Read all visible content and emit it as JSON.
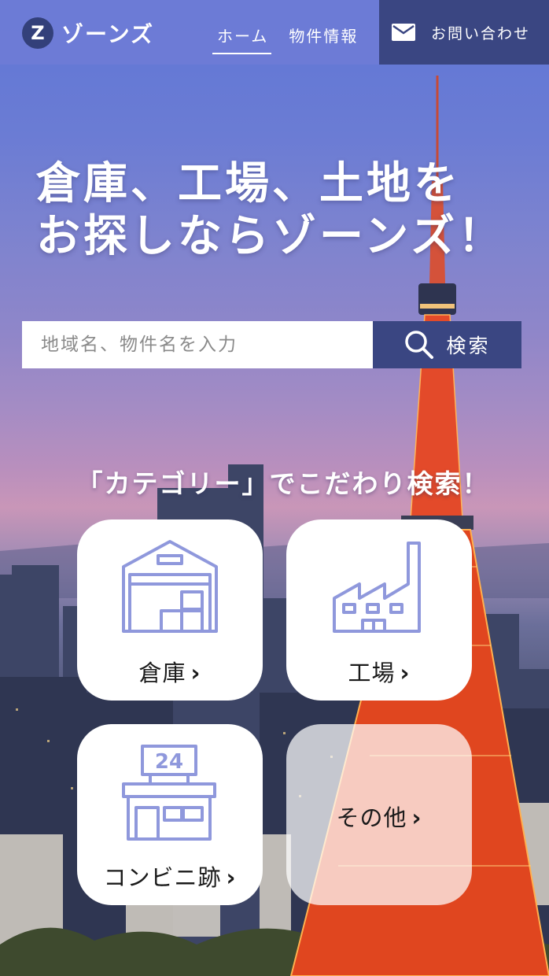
{
  "brand": {
    "logo_letter": "Z",
    "name": "ゾーンズ"
  },
  "nav": {
    "items": [
      {
        "label": "ホーム",
        "active": true
      },
      {
        "label": "物件情報",
        "active": false
      }
    ],
    "contact_label": "お問い合わせ"
  },
  "hero": {
    "title_line1": "倉庫、工場、土地を",
    "title_line2": "お探しならゾーンズ！"
  },
  "search": {
    "placeholder": "地域名、物件名を入力",
    "button_label": "検索"
  },
  "categories": {
    "heading": "「カテゴリー」でこだわり検索！",
    "items": [
      {
        "label": "倉庫",
        "icon": "warehouse-icon"
      },
      {
        "label": "工場",
        "icon": "factory-icon"
      },
      {
        "label": "コンビニ跡",
        "icon": "convenience-store-icon",
        "sign_text": "24"
      },
      {
        "label": "その他",
        "icon": ""
      }
    ],
    "chevron": "›"
  },
  "colors": {
    "header_bg": "#6e7cd6",
    "accent_dark": "#3a4682",
    "icon_stroke": "#8f98dc",
    "tower": "#e8452a"
  }
}
